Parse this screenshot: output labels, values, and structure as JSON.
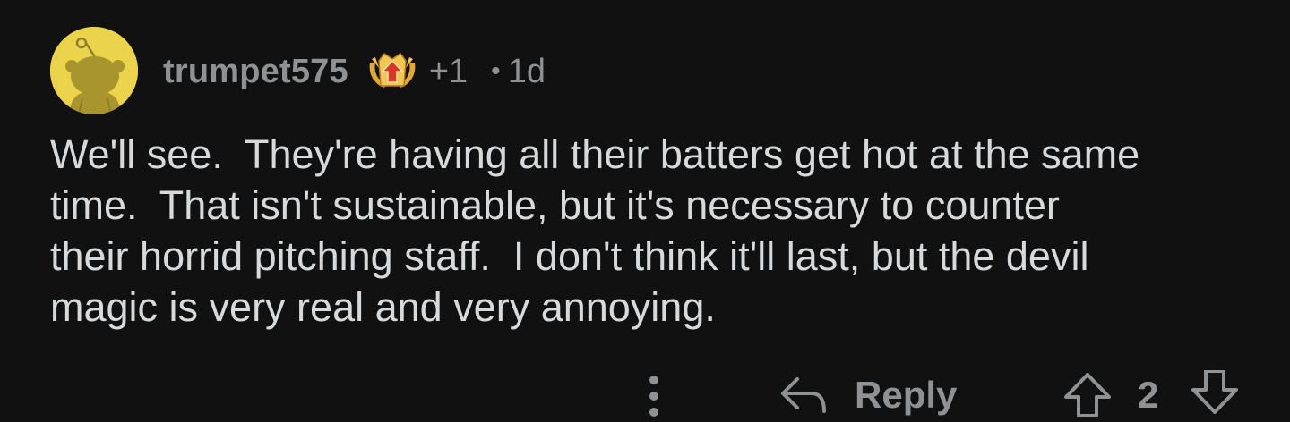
{
  "comment": {
    "username": "trumpet575",
    "award_count": "+1",
    "separator": "•",
    "age": "1d",
    "body": "We'll see.  They're having all their batters get hot at the same\ntime.  That isn't sustainable, but it's necessary to counter\ntheir horrid pitching staff.  I don't think it'll last, but the devil\nmagic is very real and very annoying."
  },
  "actions": {
    "reply_label": "Reply",
    "score": "2"
  },
  "icons": {
    "avatar": "snoo-avatar-icon",
    "award": "award-icon",
    "more": "more-options-icon",
    "reply": "reply-arrow-icon",
    "upvote": "upvote-arrow-icon",
    "downvote": "downvote-arrow-icon"
  },
  "colors": {
    "background": "#111111",
    "text": "#d7dadc",
    "muted": "#8f9294",
    "avatar_bg": "#ecd34c"
  }
}
